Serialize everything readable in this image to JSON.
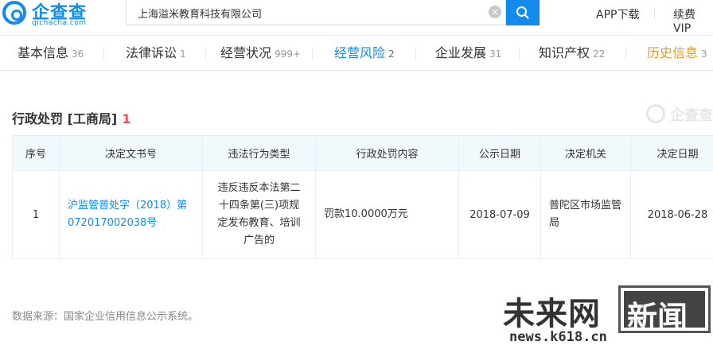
{
  "header": {
    "logo_text": "企查查",
    "logo_sub": "qichacha.com",
    "search_value": "上海溢米教育科技有限公司",
    "app_download": "APP下载",
    "renew_vip": "续费VIP"
  },
  "tabs": [
    {
      "label": "基本信息",
      "count": "36"
    },
    {
      "label": "法律诉讼",
      "count": "1"
    },
    {
      "label": "经营状况",
      "count": "999+"
    },
    {
      "label": "经营风险",
      "count": "2"
    },
    {
      "label": "企业发展",
      "count": "31"
    },
    {
      "label": "知识产权",
      "count": "22"
    },
    {
      "label": "历史信息",
      "count": "3"
    }
  ],
  "section": {
    "title": "行政处罚 [工商局]",
    "count": "1",
    "watermark_logo": "企查查"
  },
  "table": {
    "headers": [
      "序号",
      "决定文书号",
      "违法行为类型",
      "行政处罚内容",
      "公示日期",
      "决定机关",
      "决定日期"
    ],
    "rows": [
      {
        "index": "1",
        "doc_number": "沪监管普处字（2018）第072017002038号",
        "violation_type": "违反违反本法第二十四条第(三)项规定发布教育、培训广告的",
        "penalty": "罚款10.0000万元",
        "publish_date": "2018-07-09",
        "authority": "普陀区市场监管局",
        "decision_date": "2018-06-28"
      }
    ]
  },
  "footer": {
    "source_note": "数据来源：国家企业信用信息公示系统。"
  },
  "watermark": {
    "name": "未来网",
    "box_text": "新闻",
    "url": "news.k618.cn"
  },
  "colors": {
    "brand_blue": "#128bed",
    "count_red": "#fd485e",
    "history_orange": "#e09b3b"
  }
}
